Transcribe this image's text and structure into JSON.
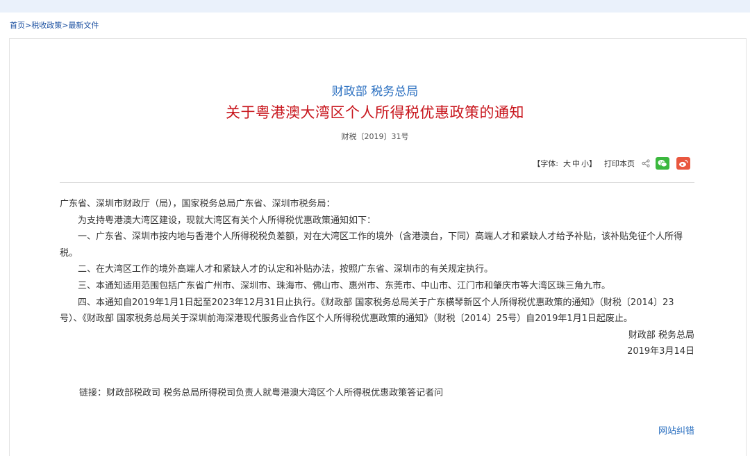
{
  "breadcrumb": {
    "home": "首页",
    "sep1": ">",
    "policy": "税收政策",
    "sep2": ">",
    "latest": "最新文件"
  },
  "article": {
    "issuer": "财政部 税务总局",
    "title": "关于粤港澳大湾区个人所得税优惠政策的通知",
    "doc_number": "财税〔2019〕31号"
  },
  "tools": {
    "font_label": "【字体:",
    "size_large": "大",
    "size_medium": "中",
    "size_small": "小】",
    "print": "打印本页",
    "share_icon": "share-icon",
    "wechat_icon": "wechat-icon",
    "weibo_icon": "weibo-icon",
    "wechat_color": "#3bb83e",
    "weibo_color": "#e9573f"
  },
  "content": {
    "salutation": "广东省、深圳市财政厅（局），国家税务总局广东省、深圳市税务局：",
    "intro": "为支持粤港澳大湾区建设，现就大湾区有关个人所得税优惠政策通知如下：",
    "p1": "一、广东省、深圳市按内地与香港个人所得税税负差额，对在大湾区工作的境外（含港澳台，下同）高端人才和紧缺人才给予补贴，该补贴免征个人所得税。",
    "p2": "二、在大湾区工作的境外高端人才和紧缺人才的认定和补贴办法，按照广东省、深圳市的有关规定执行。",
    "p3": "三、本通知适用范围包括广东省广州市、深圳市、珠海市、佛山市、惠州市、东莞市、中山市、江门市和肇庆市等大湾区珠三角九市。",
    "p4": "四、本通知自2019年1月1日起至2023年12月31日止执行。《财政部 国家税务总局关于广东横琴新区个人所得税优惠政策的通知》（财税〔2014〕23号）、《财政部 国家税务总局关于深圳前海深港现代服务业合作区个人所得税优惠政策的通知》（财税〔2014〕25号）自2019年1月1日起废止。",
    "signature": "财政部 税务总局",
    "date": "2019年3月14日"
  },
  "links": {
    "label": "链接：",
    "text": "财政部税政司 税务总局所得税司负责人就粤港澳大湾区个人所得税优惠政策答记者问"
  },
  "footer": {
    "feedback": "网站纠错"
  }
}
